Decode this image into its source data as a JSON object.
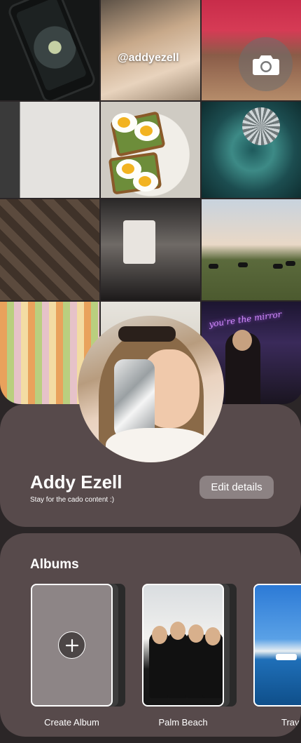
{
  "grid": {
    "handle": "@addyezell",
    "neon_text": "you're the mirror"
  },
  "camera": {
    "icon": "camera-icon"
  },
  "profile": {
    "name": "Addy Ezell",
    "bio": "Stay for the cado content :)",
    "edit_label": "Edit details"
  },
  "albums": {
    "title": "Albums",
    "items": [
      {
        "label": "Create Album",
        "icon": "plus-icon"
      },
      {
        "label": "Palm Beach"
      },
      {
        "label": "Trav"
      }
    ]
  },
  "colors": {
    "background": "#2b2627",
    "card": "#574a4b",
    "button": "#8c8283",
    "text": "#ffffff"
  }
}
